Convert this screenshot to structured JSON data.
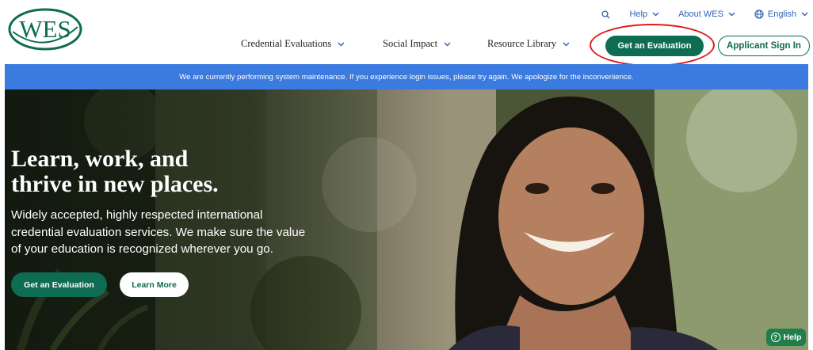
{
  "brand": {
    "logo_text": "WES",
    "accent": "#0d6c51",
    "link_blue": "#2e63b7"
  },
  "utility_nav": {
    "search_icon": "search-icon",
    "help": "Help",
    "about": "About WES",
    "language": "English"
  },
  "main_nav": {
    "items": [
      {
        "label": "Credential Evaluations"
      },
      {
        "label": "Social Impact"
      },
      {
        "label": "Resource Library"
      }
    ],
    "get_evaluation": "Get an Evaluation",
    "applicant_sign_in": "Applicant Sign In"
  },
  "banner": {
    "text": "We are currently performing system maintenance. If you experience login issues, please try again. We apologize for the inconvenience.",
    "color": "#3b7be0"
  },
  "hero": {
    "title_lines": [
      "Learn, work, and",
      "thrive in new places."
    ],
    "subtitle_lines": [
      "Widely accepted, highly respected international",
      "credential evaluation services. We make sure the value",
      "of your education is recognized wherever you go."
    ],
    "cta_primary": "Get an Evaluation",
    "cta_secondary": "Learn More"
  },
  "help_widget": {
    "label": "Help",
    "color": "#1f7e4b"
  },
  "annotation": {
    "ring_color": "#e21a1a"
  }
}
